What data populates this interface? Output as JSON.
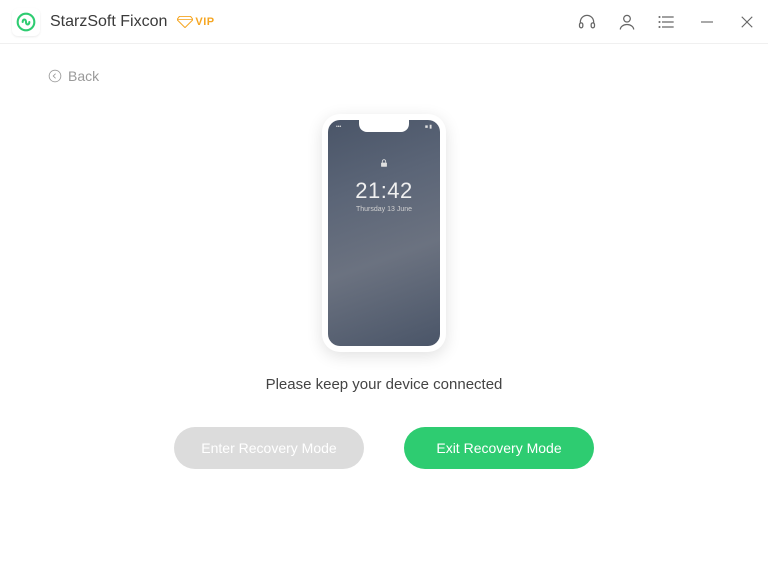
{
  "app": {
    "title": "StarzSoft Fixcon",
    "vip_label": "VIP"
  },
  "nav": {
    "back": "Back"
  },
  "phone": {
    "time": "21:42",
    "date": "Thursday 13 June",
    "status_left": "•••",
    "status_right": "■ ▮"
  },
  "main": {
    "instruction": "Please keep your device connected",
    "enter_recovery": "Enter Recovery Mode",
    "exit_recovery": "Exit Recovery Mode"
  },
  "colors": {
    "accent": "#2ecc71",
    "vip": "#f5a623"
  }
}
